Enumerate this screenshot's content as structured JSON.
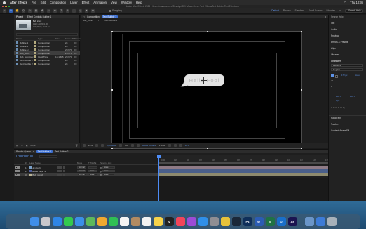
{
  "menubar": {
    "app_name": "After Effects",
    "items": [
      "File",
      "Edit",
      "Composition",
      "Layer",
      "Effect",
      "Animation",
      "View",
      "Window",
      "Help"
    ],
    "clock": "Thu 10:36"
  },
  "window_title": "Adobe After Effects 2023 - /Users/marcusrenee/Desktop/SFX Mac's Green Text Effects/Text Bubble Text Effect.aep *",
  "toolbar": {
    "snapping_label": "Snapping",
    "workspaces": [
      "Default",
      "Review",
      "Standard",
      "Small Screen",
      "Libraries"
    ],
    "active_workspace": "Default",
    "search_placeholder": "Search Help"
  },
  "project": {
    "tabs": [
      "Project",
      "Effect Controls Bubble 1"
    ],
    "selected_name": "Bub_iconc",
    "selected_info": [
      "1920 x 1080 (1.00)",
      "0;00;05;00, 29.97 fps"
    ],
    "columns": [
      "Name",
      "Type",
      "Size",
      "Frame Rat",
      "Duration"
    ],
    "items": [
      {
        "name": "Bubble 1",
        "type": "Composition",
        "size": "",
        "fps": "24",
        "dur": "0:0"
      },
      {
        "name": "Bubble 2",
        "type": "Composition",
        "size": "",
        "fps": "24",
        "dur": "0:0"
      },
      {
        "name": "Bubble_c",
        "type": "Composition",
        "size": "",
        "fps": "29.970",
        "dur": "0:0"
      },
      {
        "name": "Bub_iconc",
        "type": "Composition",
        "size": "",
        "fps": "29.970",
        "dur": "0:0"
      },
      {
        "name": "Bub_icon.mov",
        "type": "QuickTime",
        "size": "13.1 MB",
        "fps": "29.970",
        "dur": "0:0"
      },
      {
        "name": "Text Bubble 1",
        "type": "Composition",
        "size": "",
        "fps": "24",
        "dur": "0:0"
      },
      {
        "name": "Text Bubble 2",
        "type": "Composition",
        "size": "",
        "fps": "24",
        "dur": "0:0"
      }
    ],
    "selected_index": 3,
    "footer": "8 bpc"
  },
  "composition": {
    "tab_label": "Composition",
    "tab_badge": "Text Bubble 1",
    "breadcrumbs": [
      "Bub_iconc",
      "Text Bubble 1"
    ],
    "bubble_text": "Hello Fool",
    "footer": {
      "zoom": "25%",
      "timecode": "0;00;00;00",
      "resolution": "Full",
      "camera": "Active Camera",
      "views": "1 View",
      "exposure": "+0.0"
    }
  },
  "right_panel": {
    "search_label": "Search Help",
    "sections": [
      "Info",
      "Audio",
      "Preview",
      "Effects & Presets",
      "Align",
      "Libraries",
      "Character"
    ],
    "font_name": "Helvetica",
    "font_style": "Regular",
    "font_size": "172 px",
    "tracking_label": "Auto",
    "scale_vals": [
      "100 %",
      "100 %"
    ],
    "baseline": "0 px",
    "paragraph_label": "Paragraph",
    "tracker_label": "Tracker",
    "content_aware": "Content-Aware Fill"
  },
  "timeline": {
    "tabs": [
      "Render Queue",
      "Text Bubble 1",
      "Text Bubble 2"
    ],
    "active_tab": "Text Bubble 1",
    "current_time": "0:00:00:00",
    "columns": [
      "#",
      "Layer Name",
      "Mode",
      "T TrkMat",
      "Parent & Link"
    ],
    "layers": [
      {
        "num": "1",
        "name": "Hey Gurlz",
        "mode": "Normal",
        "trk": "",
        "parent": "None",
        "color": "#7aa0c8",
        "bar": "#8f7b86"
      },
      {
        "num": "2",
        "name": "Shape Layer 9",
        "mode": "Normal",
        "trk": "None",
        "parent": "None",
        "color": "#4d5c9a",
        "bar": "#4a5f8a"
      },
      {
        "num": "3",
        "name": "[Bub_iconc]",
        "mode": "Normal",
        "trk": "None",
        "parent": "None",
        "color": "#b9b394",
        "bar": "#8e8a6e"
      }
    ],
    "ruler_ticks": [
      "0:00f",
      "01f",
      "02f",
      "03f",
      "04f",
      "05f",
      "06f",
      "07f",
      "08f",
      "09f",
      "10f",
      "11f",
      "12f",
      "13f"
    ]
  },
  "dock": {
    "apps": [
      {
        "name": "finder",
        "color": "#3f8ee8"
      },
      {
        "name": "launchpad",
        "color": "#c7c7cc"
      },
      {
        "name": "safari",
        "color": "#2f86e6"
      },
      {
        "name": "messages",
        "color": "#33c94f"
      },
      {
        "name": "mail",
        "color": "#3b8fe8"
      },
      {
        "name": "maps",
        "color": "#5cb85c"
      },
      {
        "name": "photos",
        "color": "#f0a830"
      },
      {
        "name": "facetime",
        "color": "#2fbf54"
      },
      {
        "name": "calendar",
        "color": "#f4f4f4"
      },
      {
        "name": "contacts",
        "color": "#b28b62"
      },
      {
        "name": "reminders",
        "color": "#f2f2f2"
      },
      {
        "name": "notes",
        "color": "#f7d34a"
      },
      {
        "name": "tv",
        "color": "#222222"
      },
      {
        "name": "music",
        "color": "#f2455a"
      },
      {
        "name": "podcasts",
        "color": "#9c4bd6"
      },
      {
        "name": "app-store",
        "color": "#2f8fe9"
      },
      {
        "name": "system-settings",
        "color": "#8e8e93"
      },
      {
        "name": "chrome",
        "color": "#e6c13a"
      },
      {
        "name": "steam",
        "color": "#1b2838"
      },
      {
        "name": "photoshop",
        "color": "#0f2f5a"
      },
      {
        "name": "word",
        "color": "#2b5cb4"
      },
      {
        "name": "excel",
        "color": "#1f7244"
      },
      {
        "name": "outlook",
        "color": "#1a6fc9"
      },
      {
        "name": "after-effects",
        "color": "#1b1450"
      },
      {
        "name": "preview",
        "color": "#6a95c8"
      },
      {
        "name": "downloads",
        "color": "#3d7bd6"
      },
      {
        "name": "trash",
        "color": "#a7b1ba"
      }
    ],
    "labels": {
      "tv": "tv",
      "word": "W",
      "excel": "X",
      "outlook": "O",
      "after-effects": "Ae",
      "photoshop": "Ps"
    }
  }
}
